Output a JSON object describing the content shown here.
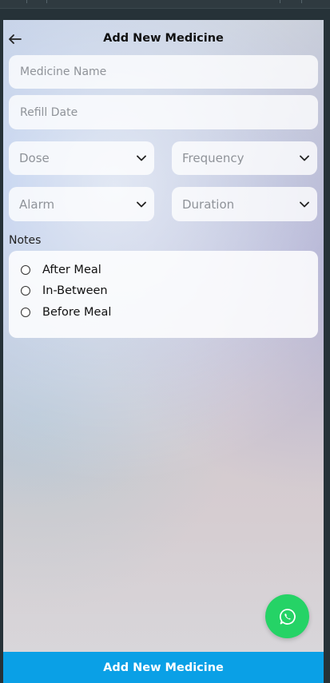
{
  "header": {
    "title": "Add New Medicine",
    "back_icon": "arrow-left-icon"
  },
  "form": {
    "medicine_name_placeholder": "Medicine Name",
    "refill_date_placeholder": "Refill Date",
    "dose_placeholder": "Dose",
    "frequency_placeholder": "Frequency",
    "alarm_placeholder": "Alarm",
    "duration_placeholder": "Duration",
    "dropdown_icon": "chevron-down-icon"
  },
  "notes": {
    "label": "Notes",
    "options": [
      "After Meal",
      "In-Between",
      "Before Meal"
    ]
  },
  "fab": {
    "icon": "whatsapp-icon",
    "color": "#25d366"
  },
  "footer": {
    "button_label": "Add New Medicine",
    "color": "#0aa0e6"
  }
}
